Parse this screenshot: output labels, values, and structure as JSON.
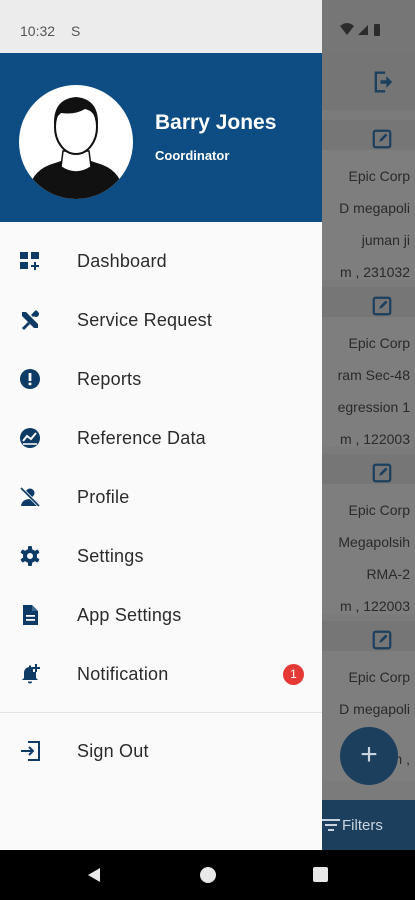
{
  "status_bar": {
    "time": "10:32",
    "sim_icon": "S"
  },
  "background": {
    "cards": [
      {
        "lines": [
          "Epic Corp",
          "D megapoli",
          "juman ji",
          "m , 231032"
        ]
      },
      {
        "lines": [
          "Epic Corp",
          "ram Sec-48",
          "egression 1",
          "m , 122003"
        ]
      },
      {
        "lines": [
          "Epic Corp",
          "Megapolsih",
          "RMA-2",
          "m , 122003"
        ]
      },
      {
        "lines": [
          "Epic Corp",
          "D megapoli",
          "",
          "m ,"
        ]
      }
    ],
    "fab_icon": "+",
    "filters_label": "Filters"
  },
  "drawer": {
    "user": {
      "name": "Barry Jones",
      "role": "Coordinator"
    },
    "items": [
      {
        "label": "Dashboard",
        "icon": "dashboard-icon"
      },
      {
        "label": "Service Request",
        "icon": "tools-icon"
      },
      {
        "label": "Reports",
        "icon": "alert-icon"
      },
      {
        "label": "Reference Data",
        "icon": "trend-icon"
      },
      {
        "label": "Profile",
        "icon": "person-off-icon"
      },
      {
        "label": "Settings",
        "icon": "gear-icon"
      },
      {
        "label": "App Settings",
        "icon": "document-icon"
      },
      {
        "label": "Notification",
        "icon": "bell-add-icon",
        "badge": "1"
      }
    ],
    "sign_out": {
      "label": "Sign Out",
      "icon": "sign-in-icon"
    }
  },
  "colors": {
    "primary": "#0e4d83",
    "badge": "#e53935",
    "icon": "#0e3a66"
  }
}
